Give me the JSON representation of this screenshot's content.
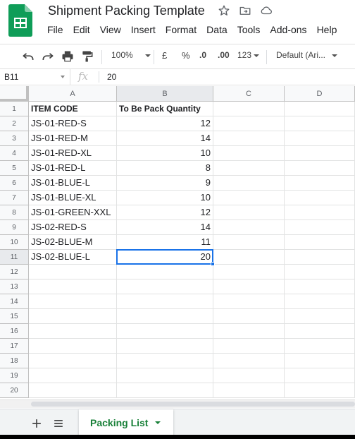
{
  "document": {
    "title": "Shipment Packing Template"
  },
  "menu": [
    "File",
    "Edit",
    "View",
    "Insert",
    "Format",
    "Data",
    "Tools",
    "Add-ons",
    "Help"
  ],
  "toolbar": {
    "zoom": "100%",
    "currency": "£",
    "percent": "%",
    "decrease_decimal": ".0",
    "increase_decimal": ".00",
    "more_formats": "123",
    "font": "Default (Ari..."
  },
  "formula_bar": {
    "cell_ref": "B11",
    "fx": "fx",
    "value": "20"
  },
  "columns": [
    "A",
    "B",
    "C",
    "D"
  ],
  "rows": [
    "1",
    "2",
    "3",
    "4",
    "5",
    "6",
    "7",
    "8",
    "9",
    "10",
    "11",
    "12",
    "13",
    "14",
    "15",
    "16",
    "17",
    "18",
    "19",
    "20"
  ],
  "sheet": {
    "headers": [
      "ITEM CODE",
      "To Be Pack Quantity"
    ],
    "data": [
      [
        "JS-01-RED-S",
        "12"
      ],
      [
        "JS-01-RED-M",
        "14"
      ],
      [
        "JS-01-RED-XL",
        "10"
      ],
      [
        "JS-01-RED-L",
        "8"
      ],
      [
        "JS-01-BLUE-L",
        "9"
      ],
      [
        "JS-01-BLUE-XL",
        "10"
      ],
      [
        "JS-01-GREEN-XXL",
        "12"
      ],
      [
        "JS-02-RED-S",
        "14"
      ],
      [
        "JS-02-BLUE-M",
        "11"
      ],
      [
        "JS-02-BLUE-L",
        "20"
      ]
    ]
  },
  "tabs": {
    "active": "Packing List"
  },
  "colors": {
    "sheets_green": "#0f9d58",
    "selection_blue": "#1a73e8",
    "tab_green": "#188038"
  },
  "icons": [
    "sheets-logo-icon",
    "star-icon",
    "move-folder-icon",
    "cloud-status-icon",
    "undo-icon",
    "redo-icon",
    "print-icon",
    "paint-format-icon",
    "add-sheet-icon",
    "all-sheets-icon"
  ]
}
